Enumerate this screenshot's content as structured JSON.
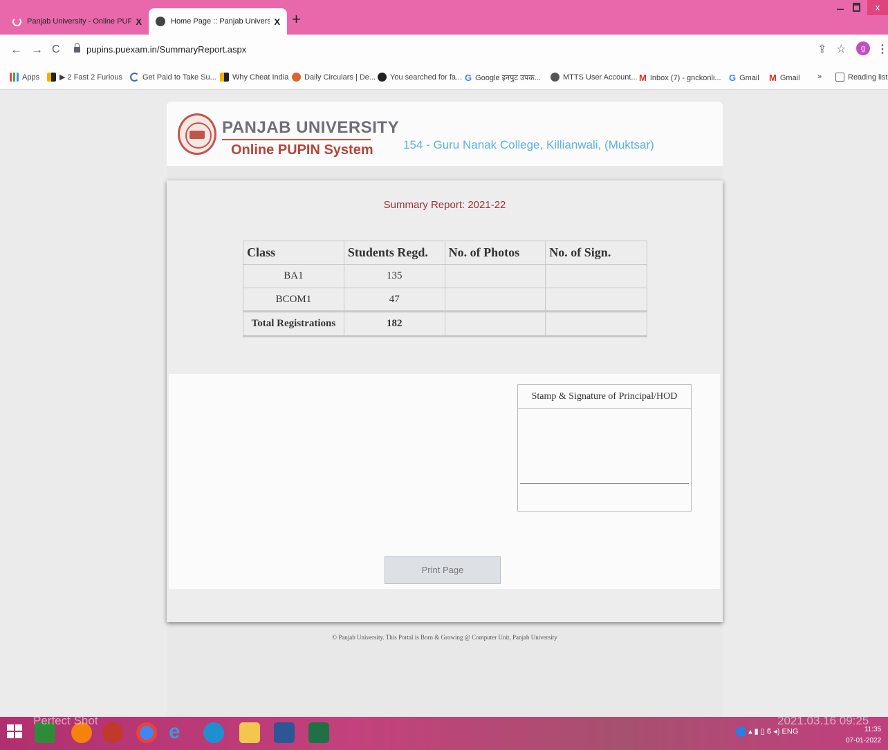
{
  "browser": {
    "tabs": [
      {
        "title": "Panjab University - Online PUPIN",
        "close": "X"
      },
      {
        "title": "Home Page :: Panjab University -",
        "close": "X"
      }
    ],
    "new_tab": "+",
    "window_controls": {
      "minimize": "–",
      "close": "x"
    },
    "nav": {
      "back": "←",
      "forward": "→",
      "reload": "C"
    },
    "url": "pupins.puexam.in/SummaryReport.aspx",
    "profile_initial": "g",
    "bookmarks": [
      {
        "label": "Apps",
        "icon": "apps-grid-icon"
      },
      {
        "label": "▶ 2 Fast 2 Furious",
        "icon": "plex-icon"
      },
      {
        "label": "Get Paid to Take Su...",
        "icon": "swagbucks-icon"
      },
      {
        "label": "Why Cheat India",
        "icon": "plex-icon"
      },
      {
        "label": "Daily Circulars | De...",
        "icon": "site-icon"
      },
      {
        "label": "You searched for fa...",
        "icon": "site-icon"
      },
      {
        "label": "Google इनपुट उपक...",
        "icon": "google-icon"
      },
      {
        "label": "MTTS User Account...",
        "icon": "globe-icon"
      },
      {
        "label": "Inbox (7) - gnckonli...",
        "icon": "gmail-icon"
      },
      {
        "label": "Gmail",
        "icon": "google-icon"
      },
      {
        "label": "Gmail",
        "icon": "gmail-icon"
      }
    ],
    "overflow": "»",
    "reading_list": "Reading list"
  },
  "header": {
    "brand": "PANJAB UNIVERSITY",
    "subtitle": "Online PUPIN System",
    "college": "154 - Guru Nanak College, Killianwali, (Muktsar)"
  },
  "report": {
    "title": "Summary Report: 2021-22",
    "columns": [
      "Class",
      "Students Regd.",
      "No. of Photos",
      "No. of Sign."
    ],
    "rows": [
      {
        "class": "BA1",
        "students": "135",
        "photos": "",
        "sign": ""
      },
      {
        "class": "BCOM1",
        "students": "47",
        "photos": "",
        "sign": ""
      }
    ],
    "total": {
      "label": "Total Registrations",
      "students": "182",
      "photos": "",
      "sign": ""
    },
    "stamp_label": "Stamp & Signature of Principal/HOD",
    "print_button": "Print Page"
  },
  "footer": "© Panjab University. This Portal is Born & Growing @ Computer Unit, Panjab University",
  "taskbar": {
    "watermark": "Perfect Shot",
    "watermark_date": "2021.03.16 09:25",
    "lang": "ENG",
    "time": "11:35",
    "date": "07-01-2022"
  }
}
